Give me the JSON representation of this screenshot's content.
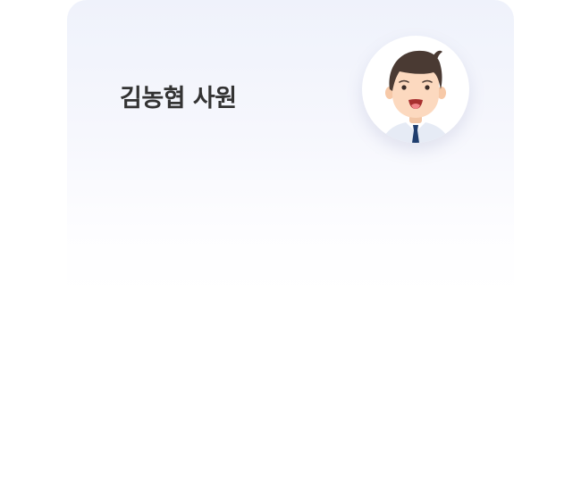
{
  "profile": {
    "name": "김농협 사원",
    "avatar_icon": "employee-avatar-icon"
  },
  "colors": {
    "name_text": "#333333",
    "card_gradient_top": "#eff2fb",
    "card_gradient_bottom": "#ffffff",
    "hair": "#4a3a33",
    "skin": "#fcd9bf",
    "tie": "#1f3d6e",
    "shirt": "#e6ebf5"
  }
}
